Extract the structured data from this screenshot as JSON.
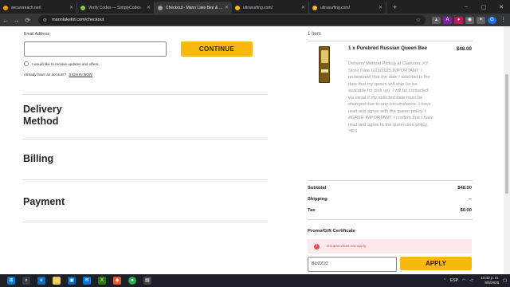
{
  "browser": {
    "tabs": [
      {
        "title": "securereach.net/",
        "color": "#ff9800",
        "active": false
      },
      {
        "title": "Verify Codes — SimplyCodes",
        "color": "#8bc34a",
        "active": false
      },
      {
        "title": "Checkout - Mann Lake Bee & Ag",
        "color": "#9e9e9e",
        "active": true
      },
      {
        "title": "ultrasurfing.com/",
        "color": "#f9b90e",
        "active": false
      },
      {
        "title": "ultrasurfing.com/",
        "color": "#f9b90e",
        "active": false
      }
    ],
    "url": "mannlakeltd.com/checkout"
  },
  "left": {
    "email_label": "Email Address",
    "email_value": "",
    "continue_label": "CONTINUE",
    "newsletter_label": "I would like to receive updates and offers.",
    "account_text": "Already have an account?",
    "signin_label": "SIGN IN NOW",
    "delivery_title": "Delivery Method",
    "billing_title": "Billing",
    "payment_title": "Payment"
  },
  "summary": {
    "item_count": "1 Item",
    "product_name": "1 x Purebred Russian Queen Bee",
    "product_price": "$48.00",
    "product_desc": "Delivery Method Pickup at Clarkson, KY Store Date 6/21/2025 IMPORTANT: I understand that the date I selected is the date that my queen will ship (or be available for pick up). I will be contacted via email if my selected date must be changed due to any circumstance. I have read and agree with the queen policy. I AGREE IMPORTANT: I confirm that I have read and agree to the queen bee policy. YES",
    "subtotal_label": "Subtotal",
    "subtotal_value": "$48.00",
    "shipping_label": "Shipping",
    "shipping_value": "--",
    "tax_label": "Tax",
    "tax_value": "$0.00",
    "promo_label": "Promo/Gift Certificate",
    "promo_error": "Coupon does not apply.",
    "promo_value": "BUZZ10",
    "apply_label": "APPLY"
  },
  "taskbar": {
    "lang": "ESP",
    "time": "10:42 p. m.",
    "date": "8/5/2025"
  },
  "colors": {
    "accent": "#f9b90e",
    "error": "#d9534f",
    "error_bg": "#fbe9eb"
  }
}
